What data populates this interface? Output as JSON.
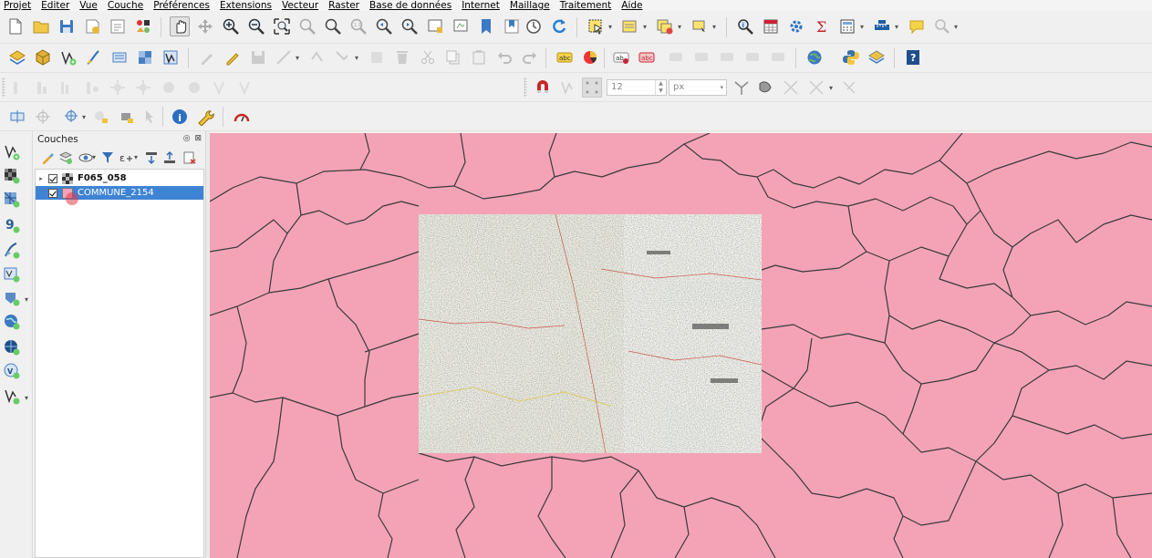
{
  "menubar": {
    "items": [
      "Projet",
      "Editer",
      "Vue",
      "Couche",
      "Préférences",
      "Extensions",
      "Vecteur",
      "Raster",
      "Base de données",
      "Internet",
      "Maillage",
      "Traitement",
      "Aide"
    ]
  },
  "style_toolbar": {
    "size_value": "12",
    "unit_value": "px"
  },
  "layers_panel": {
    "title": "Couches",
    "controls": "◎ ⊠",
    "layers": [
      {
        "name": "F065_058",
        "checked": true,
        "type": "raster",
        "expanded": false,
        "selected": false
      },
      {
        "name": "COMMUNE_2154",
        "checked": true,
        "type": "polygon",
        "selected": true,
        "fill_color": "#f4a3b6"
      }
    ]
  },
  "map": {
    "polygon_fill": "#f4a3b6",
    "boundary_color": "#3a3a3a",
    "raster_layer": "F065_058"
  },
  "colors": {
    "selection": "#3f84d4",
    "accent_red": "#c8282a"
  }
}
